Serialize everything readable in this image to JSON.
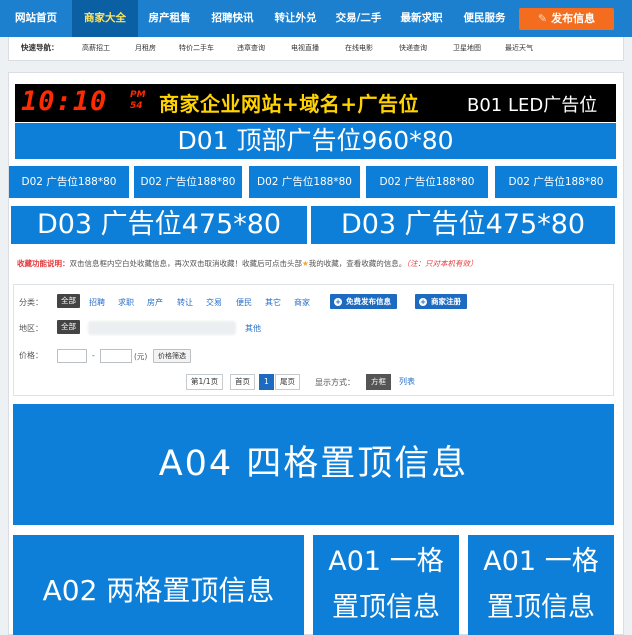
{
  "nav": {
    "items": [
      "网站首页",
      "商家大全",
      "房产租售",
      "招聘快讯",
      "转让外兑",
      "交易/二手",
      "最新求职",
      "便民服务"
    ],
    "publish_label": "发布信息"
  },
  "quicknav": {
    "label": "快速导航：",
    "links": [
      "高薪招工",
      "月租房",
      "特价二手车",
      "违章查询",
      "电视直播",
      "在线电影",
      "快递查询",
      "卫星地图",
      "最近天气"
    ]
  },
  "led": {
    "clock": "10:10",
    "ampm_top": "PM",
    "ampm_bottom": "54",
    "text": "商家企业网站+域名+广告位",
    "code": "B01  LED广告位"
  },
  "ads": {
    "d01": "D01 顶部广告位960*80",
    "d02": [
      "D02 广告位188*80",
      "D02 广告位188*80",
      "D02 广告位188*80",
      "D02 广告位188*80",
      "D02 广告位188*80"
    ],
    "d03": [
      "D03 广告位475*80",
      "D03 广告位475*80"
    ]
  },
  "favorites": {
    "label": "收藏功能说明：",
    "text1": "双击信息框内空白处收藏信息，再次双击取消收藏！收藏后可点击头部",
    "link": "我的收藏",
    "text2": "，查看收藏的信息。",
    "note": "（注：只对本机有效）"
  },
  "filter": {
    "category_label": "分类：",
    "all_label": "全部",
    "categories": [
      "招聘",
      "求职",
      "房产",
      "转让",
      "交易",
      "便民",
      "其它",
      "商家"
    ],
    "free_publish": "免费发布信息",
    "merchant_register": "商家注册",
    "region_label": "地区：",
    "region_other": "其他",
    "price_label": "价格：",
    "price_dash": "-",
    "price_unit": "(元)",
    "price_filter": "价格筛选"
  },
  "pager": {
    "page_info": "第1/1页",
    "first": "首页",
    "current": "1",
    "last": "尾页",
    "display_label": "显示方式：",
    "mode_grid": "方框",
    "mode_list": "列表"
  },
  "blocks": {
    "a04": "A04 四格置顶信息",
    "a02": "A02 两格置顶信息",
    "a01_line1": "A01 一格",
    "a01_line2": "置顶信息"
  },
  "colors": {
    "nav_bg": "#1d80cf",
    "ad_blue": "#0d7fd8",
    "publish_orange": "#f46d1e",
    "led_red": "#ff2a00",
    "led_yellow": "#ffd200"
  }
}
